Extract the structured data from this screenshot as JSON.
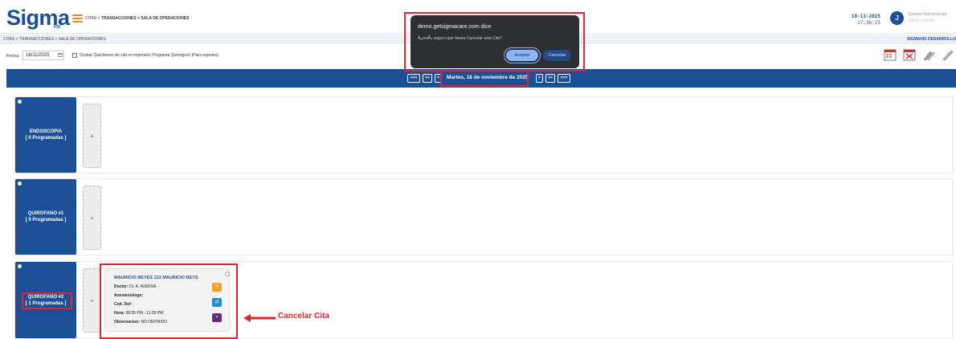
{
  "header": {
    "logo_text": "Sigma",
    "logo_sub": "HIS",
    "breadcrumb_prefix": "CITAS > ",
    "breadcrumb_bold": "TRANSACCIONES > SALA DE OPERACIONES",
    "date": "18-11-2025",
    "time": "17:36:25",
    "avatar_initial": "J",
    "user_role": "System Administrad",
    "user_name": "Johan Garcia"
  },
  "subbar": {
    "breadcrumb": "CITAS > TRANSACCIONES > SALA DE OPERACIONES",
    "environment": "SIGMAHIS DESARROLLO"
  },
  "toolbar": {
    "date_label": "Fecha",
    "date_value": "18/11/2025",
    "checkbox_label": "Ocultar Quirófanos sin cita en impresión Programa Quirúrgico! (Para reportes)"
  },
  "nav": {
    "first": "<<<",
    "prev_week": "<<",
    "prev": "<",
    "current_date": "Martes, 18 de noviembre de 2025",
    "next": ">",
    "next_week": ">>",
    "last": ">>>"
  },
  "rooms": [
    {
      "name": "ENDOSCOPIA",
      "count": "[ 0 Programadas ]"
    },
    {
      "name": "QUIROFANO #1",
      "count": "[ 0 Programadas ]"
    },
    {
      "name": "QUIROFANO #2",
      "count": "[ 1 Programadas ]"
    }
  ],
  "add_symbol": "+",
  "appointment": {
    "patient": "MAURICIO REYES 123 MAURICIO REYS",
    "doctor_label": "Doctor:",
    "doctor": "Dr. A. AVERSA",
    "anest_label": "Anestesiologo:",
    "ref_label": "Cod. Ref:",
    "hora_label": "Hora:",
    "hora": "08:35 PM - 11:05 PM",
    "obs_label": "Observacion:",
    "obs": "NO DEFINIDO"
  },
  "annotation": {
    "label": "Cancelar Cita"
  },
  "dialog": {
    "origin": "demo.getsigmacare.com dice",
    "message": "Â¿estÃ¡ seguro que desea Cancelar esta Cita?",
    "ok_label": "Aceptar",
    "cancel_label": "Cancelar"
  },
  "colors": {
    "primary": "#1b4f96",
    "accent": "#e98a2a",
    "annotation": "#e0242b",
    "edit": "#f0a030",
    "transfer": "#1a8fd0",
    "delete": "#6b2a7a"
  }
}
